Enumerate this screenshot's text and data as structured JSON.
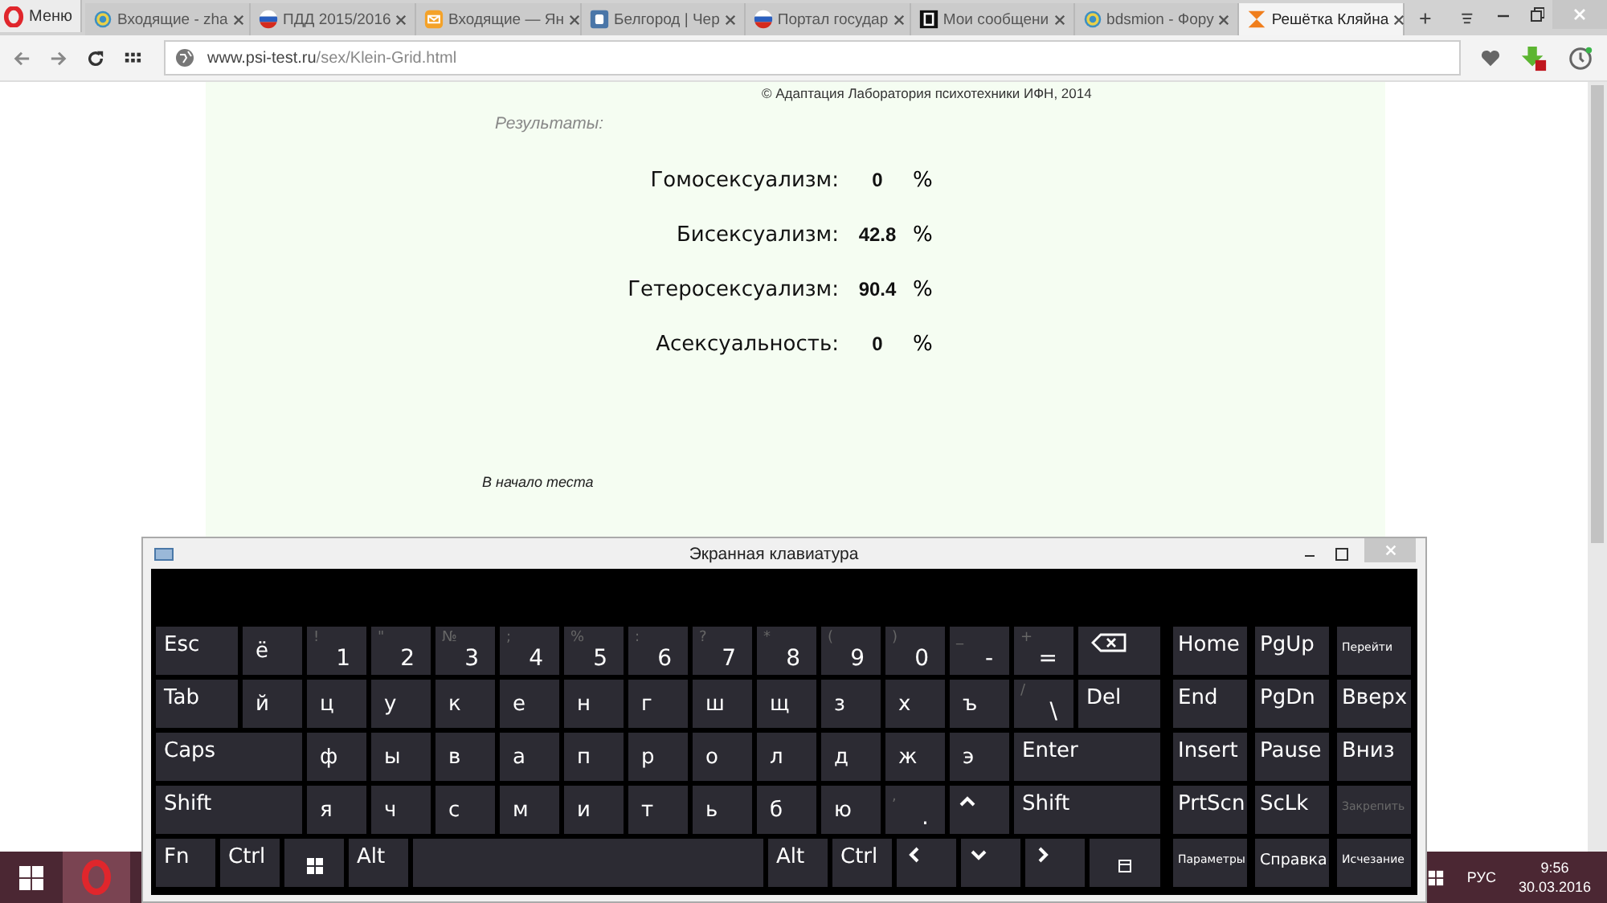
{
  "browser": {
    "menu_label": "Меню",
    "tabs": [
      {
        "title": "Входящие - zha",
        "kind": "ring",
        "selected": false
      },
      {
        "title": "ПДД 2015/2016",
        "kind": "flag",
        "selected": false
      },
      {
        "title": "Входящие — Ян",
        "kind": "mail",
        "selected": false
      },
      {
        "title": "Белгород | Чер",
        "kind": "blue",
        "selected": false
      },
      {
        "title": "Портал государ",
        "kind": "flag",
        "selected": false
      },
      {
        "title": "Мои сообщени",
        "kind": "dark",
        "selected": false
      },
      {
        "title": "bdsmion - Фору",
        "kind": "ring",
        "selected": false
      },
      {
        "title": "Решётка Кляйна",
        "kind": "hourglass",
        "selected": true
      }
    ],
    "url_host": "www.psi-test.ru",
    "url_path": "/sex/Klein-Grid.html"
  },
  "page": {
    "copyright": "©  Адаптация Лаборатория психотехники ИФН, 2014",
    "section_title": "Результаты:",
    "results": [
      {
        "label": "Гомосексуализм:",
        "value": "0",
        "unit": "%"
      },
      {
        "label": "Бисексуализм:",
        "value": "42.8",
        "unit": "%"
      },
      {
        "label": "Гетеросексуализм:",
        "value": "90.4",
        "unit": "%"
      },
      {
        "label": "Асексуальность:",
        "value": "0",
        "unit": "%"
      }
    ],
    "link": "В начало теста"
  },
  "keyboard": {
    "title": "Экранная клавиатура",
    "rows": [
      {
        "keys": [
          {
            "kind": "label",
            "label": "Esc"
          },
          {
            "kind": "char",
            "label": "ё"
          },
          {
            "kind": "shifted",
            "shift": "!",
            "label": "1"
          },
          {
            "kind": "shifted",
            "shift": "\"",
            "label": "2"
          },
          {
            "kind": "shifted",
            "shift": "№",
            "label": "3"
          },
          {
            "kind": "shifted",
            "shift": ";",
            "label": "4"
          },
          {
            "kind": "shifted",
            "shift": "%",
            "label": "5"
          },
          {
            "kind": "shifted",
            "shift": ":",
            "label": "6"
          },
          {
            "kind": "shifted",
            "shift": "?",
            "label": "7"
          },
          {
            "kind": "shifted",
            "shift": "*",
            "label": "8"
          },
          {
            "kind": "shifted",
            "shift": "(",
            "label": "9"
          },
          {
            "kind": "shifted",
            "shift": ")",
            "label": "0"
          },
          {
            "kind": "shifted",
            "shift": "_",
            "label": "-"
          },
          {
            "kind": "shifted",
            "shift": "+",
            "label": "="
          },
          {
            "kind": "backspace"
          }
        ]
      },
      {
        "keys": [
          {
            "kind": "label",
            "label": "Tab"
          },
          {
            "kind": "char",
            "label": "й"
          },
          {
            "kind": "char",
            "label": "ц"
          },
          {
            "kind": "char",
            "label": "у"
          },
          {
            "kind": "char",
            "label": "к"
          },
          {
            "kind": "char",
            "label": "е"
          },
          {
            "kind": "char",
            "label": "н"
          },
          {
            "kind": "char",
            "label": "г"
          },
          {
            "kind": "char",
            "label": "ш"
          },
          {
            "kind": "char",
            "label": "щ"
          },
          {
            "kind": "char",
            "label": "з"
          },
          {
            "kind": "char",
            "label": "х"
          },
          {
            "kind": "char",
            "label": "ъ"
          },
          {
            "kind": "shifted",
            "shift": "/",
            "label": "\\"
          },
          {
            "kind": "label",
            "label": "Del"
          }
        ]
      },
      {
        "keys": [
          {
            "kind": "label",
            "label": "Caps"
          },
          {
            "kind": "char",
            "label": "ф"
          },
          {
            "kind": "char",
            "label": "ы"
          },
          {
            "kind": "char",
            "label": "в"
          },
          {
            "kind": "char",
            "label": "а"
          },
          {
            "kind": "char",
            "label": "п"
          },
          {
            "kind": "char",
            "label": "р"
          },
          {
            "kind": "char",
            "label": "о"
          },
          {
            "kind": "char",
            "label": "л"
          },
          {
            "kind": "char",
            "label": "д"
          },
          {
            "kind": "char",
            "label": "ж"
          },
          {
            "kind": "char",
            "label": "э"
          },
          {
            "kind": "label",
            "label": "Enter"
          }
        ]
      },
      {
        "keys": [
          {
            "kind": "label",
            "label": "Shift"
          },
          {
            "kind": "char",
            "label": "я"
          },
          {
            "kind": "char",
            "label": "ч"
          },
          {
            "kind": "char",
            "label": "с"
          },
          {
            "kind": "char",
            "label": "м"
          },
          {
            "kind": "char",
            "label": "и"
          },
          {
            "kind": "char",
            "label": "т"
          },
          {
            "kind": "char",
            "label": "ь"
          },
          {
            "kind": "char",
            "label": "б"
          },
          {
            "kind": "char",
            "label": "ю"
          },
          {
            "kind": "shifted",
            "shift": ",",
            "label": "."
          },
          {
            "kind": "up"
          },
          {
            "kind": "label",
            "label": "Shift"
          }
        ]
      },
      {
        "keys": [
          {
            "kind": "fixed",
            "label": "Fn"
          },
          {
            "kind": "fixed",
            "label": "Ctrl"
          },
          {
            "kind": "win"
          },
          {
            "kind": "fixed",
            "label": "Alt"
          },
          {
            "kind": "space"
          },
          {
            "kind": "fixed",
            "label": "Alt"
          },
          {
            "kind": "fixed",
            "label": "Ctrl"
          },
          {
            "kind": "left"
          },
          {
            "kind": "down"
          },
          {
            "kind": "right"
          },
          {
            "kind": "menu"
          }
        ]
      }
    ],
    "nav_columns": [
      [
        {
          "kind": "label",
          "label": "Home",
          "disabled": false
        },
        {
          "kind": "label",
          "label": "End",
          "disabled": false
        },
        {
          "kind": "label",
          "label": "Insert",
          "disabled": false
        },
        {
          "kind": "label",
          "label": "PrtScn",
          "disabled": false
        },
        {
          "kind": "small",
          "label": "Параметры",
          "disabled": false
        }
      ],
      [
        {
          "kind": "label",
          "label": "PgUp",
          "disabled": false
        },
        {
          "kind": "label",
          "label": "PgDn",
          "disabled": false
        },
        {
          "kind": "label",
          "label": "Pause",
          "disabled": false
        },
        {
          "kind": "label",
          "label": "ScLk",
          "disabled": false
        },
        {
          "kind": "mid",
          "label": "Справка",
          "disabled": false
        }
      ],
      [
        {
          "kind": "small",
          "label": "Перейти",
          "disabled": false
        },
        {
          "kind": "label",
          "label": "Вверх",
          "disabled": false
        },
        {
          "kind": "label",
          "label": "Вниз",
          "disabled": false
        },
        {
          "kind": "small",
          "label": "Закрепить",
          "disabled": true
        },
        {
          "kind": "small",
          "label": "Исчезание",
          "disabled": false
        }
      ]
    ]
  },
  "taskbar": {
    "apps": [
      {
        "selected": true
      }
    ],
    "language": "РУС",
    "time": "9:56",
    "date": "30.03.2016"
  }
}
